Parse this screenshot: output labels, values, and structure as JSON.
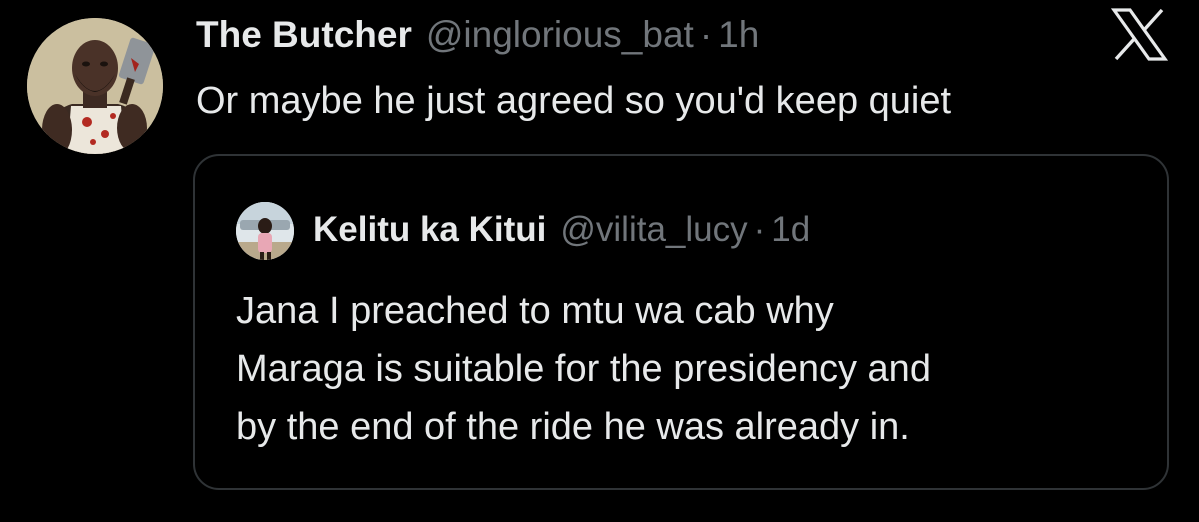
{
  "colors": {
    "background": "#000000",
    "text_primary": "#e7e9ea",
    "text_secondary": "#71767b",
    "border": "#2f3336"
  },
  "tweet": {
    "display_name": "The Butcher",
    "handle": "@inglorious_bat",
    "separator": "·",
    "time": "1h",
    "text": "Or maybe he just agreed so you'd keep quiet",
    "avatar_icon": "butcher-avatar",
    "action_icon": "x-logo-icon"
  },
  "quote": {
    "display_name": "Kelitu ka Kitui",
    "handle": "@vilita_lucy",
    "separator": "·",
    "time": "1d",
    "avatar_icon": "user-avatar",
    "text_lines": [
      "Jana I preached to mtu wa cab why",
      "Maraga is suitable for the presidency and",
      "by the end of the ride he was already in."
    ]
  }
}
